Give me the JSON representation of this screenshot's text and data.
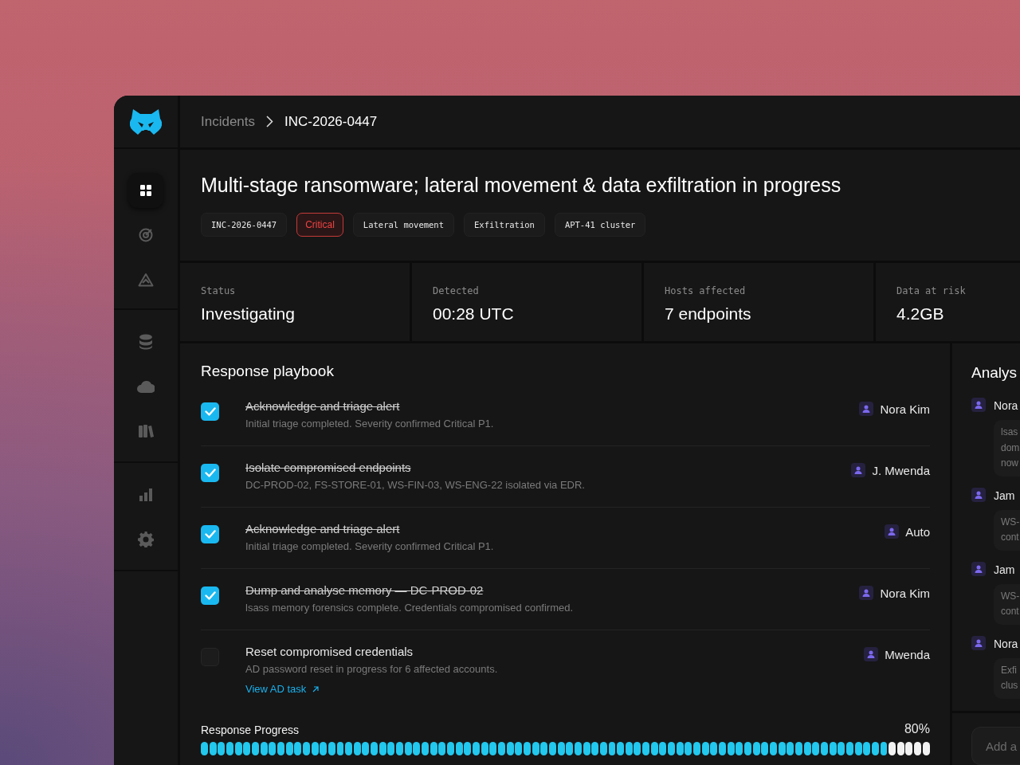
{
  "sidebar": {
    "groups": [
      {
        "items": [
          {
            "kind": "grid",
            "selected": true
          },
          {
            "kind": "target",
            "selected": false
          },
          {
            "kind": "warning",
            "selected": false
          }
        ]
      },
      {
        "items": [
          {
            "kind": "database",
            "selected": false
          },
          {
            "kind": "cloud",
            "selected": false
          },
          {
            "kind": "books",
            "selected": false
          }
        ]
      },
      {
        "items": [
          {
            "kind": "chart",
            "selected": false
          },
          {
            "kind": "gear",
            "selected": false
          }
        ]
      }
    ]
  },
  "breadcrumb": [
    {
      "label": "Incidents",
      "current": false
    },
    {
      "label": "INC-2026-0447",
      "current": true
    }
  ],
  "incident": {
    "title": "Multi-stage ransomware; lateral movement & data exfiltration in progress",
    "tags": [
      {
        "label": "INC-2026-0447",
        "kind": "plain"
      },
      {
        "label": "Critical",
        "kind": "critical"
      },
      {
        "label": "Lateral movement",
        "kind": "plain"
      },
      {
        "label": "Exfiltration",
        "kind": "plain"
      },
      {
        "label": "APT-41 cluster",
        "kind": "plain"
      }
    ]
  },
  "stats": [
    {
      "label": "Status",
      "value": "Investigating"
    },
    {
      "label": "Detected",
      "value": "00:28 UTC"
    },
    {
      "label": "Hosts affected",
      "value": "7 endpoints"
    },
    {
      "label": "Data at risk",
      "value": "4.2GB"
    }
  ],
  "playbook": {
    "title": "Response playbook",
    "steps": [
      {
        "title": "Acknowledge and triage alert",
        "detail": "Initial triage completed. Severity confirmed Critical P1.",
        "assignee": "Nora Kim",
        "checked": true
      },
      {
        "title": "Isolate compromised endpoints",
        "detail": "DC-PROD-02, FS-STORE-01, WS-FIN-03, WS-ENG-22 isolated via EDR.",
        "assignee": "J. Mwenda",
        "checked": true
      },
      {
        "title": "Acknowledge and triage alert",
        "detail": "Initial triage completed. Severity confirmed Critical P1.",
        "assignee": "Auto",
        "checked": true
      },
      {
        "title": "Dump and analyse memory — DC-PROD-02",
        "detail": "lsass memory forensics complete. Credentials compromised confirmed.",
        "assignee": "Nora Kim",
        "checked": true
      },
      {
        "title": "Reset compromised credentials",
        "detail": "AD password reset in progress for 6 affected accounts.",
        "assignee": "Mwenda",
        "checked": false,
        "link": "View AD task"
      }
    ],
    "progress": {
      "label": "Response Progress",
      "reading": "80%",
      "level": 0.94
    }
  },
  "notes": {
    "title": "Analys",
    "items": [
      {
        "author": "Nora",
        "lines": [
          "lsas",
          "dom",
          "now"
        ]
      },
      {
        "author": "Jam",
        "lines": [
          "WS-",
          "cont"
        ]
      },
      {
        "author": "Jam",
        "lines": [
          "WS-",
          "cont"
        ]
      },
      {
        "author": "Nora",
        "lines": [
          "Exfi",
          "clus"
        ]
      }
    ],
    "composer": {
      "placeholder": "Add a"
    }
  }
}
